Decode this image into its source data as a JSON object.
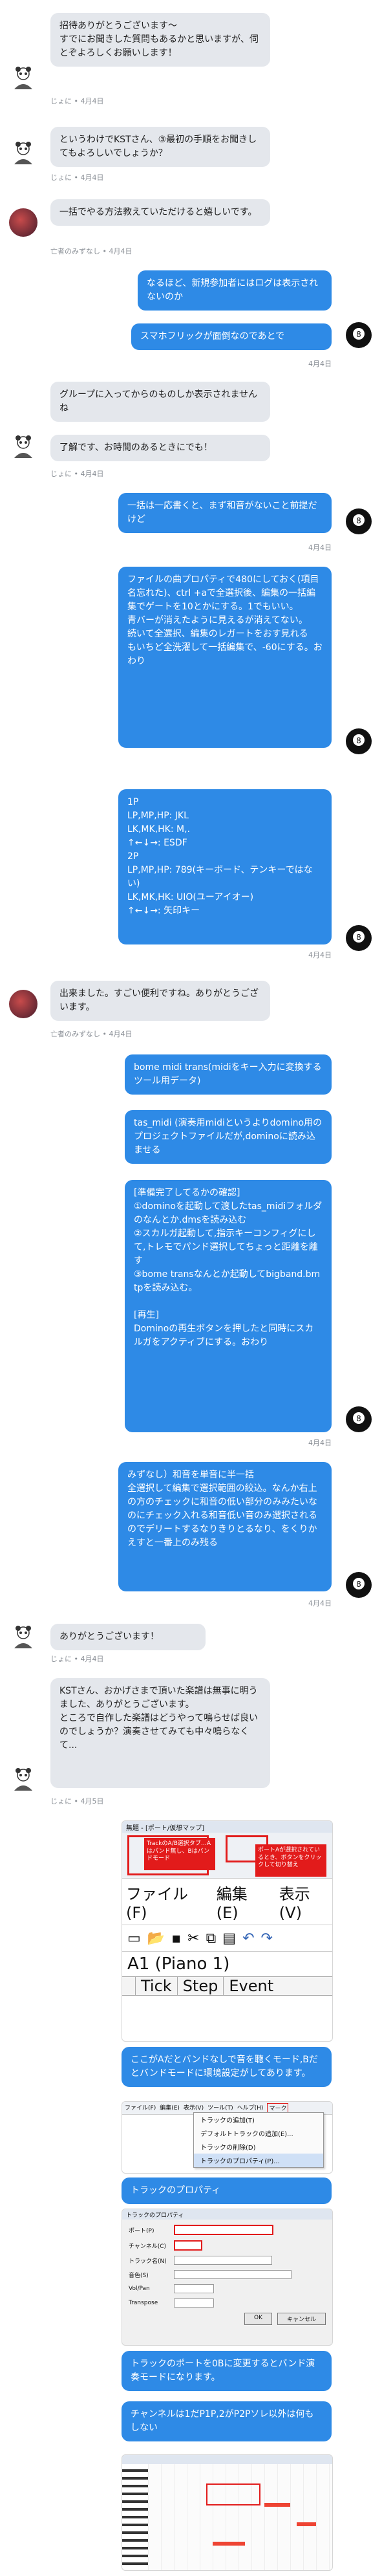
{
  "messages": [
    {
      "text": "招待ありがとうございます〜\nすでにお聞きした質問もあるかと思いますが、伺とぞよろしくお願いします！",
      "meta": "じょに • 4月4日"
    },
    {
      "text": "というわけでKSTさん、③最初の手順をお聞きしてもよろしいでしょうか？",
      "meta": "じょに • 4月4日"
    },
    {
      "text": "一括でやる方法教えていただけると嬉しいです。",
      "meta": "亡者のみずなし • 4月4日"
    },
    {
      "text": "なるほど、新規参加者にはログは表示されないのか"
    },
    {
      "text": "スマホフリックが面倒なのであとで",
      "meta": "4月4日"
    },
    {
      "text": "グループに入ってからのものしか表示されませんね"
    },
    {
      "text": "了解です、お時間のあるときにでも！",
      "meta": "じょに • 4月4日"
    },
    {
      "text": "一括は一応書くと、まず和音がないこと前提だけど",
      "meta": "4月4日"
    },
    {
      "text": "ファイルの曲プロパティで480にしておく(項目名忘れた)、ctrl +aで全選択後、編集の一括編集でゲートを10とかにする。1でもいい。\n青バーが消えたように見えるが消えてない。\n続いて全選択、編集のレガートをおす見れる\nもいちど全洗濯して一括編集で、-60にする。おわり"
    },
    {
      "text": "1P\n LP,MP,HP: JKL\n LK,MK,HK: M,.\n ↑←↓→: ESDF\n2P\n LP,MP,HP: 789(キーボード、テンキーではない)\n LK,MK,HK: UIO(ユーアイオー)\n ↑←↓→: 矢印キー",
      "meta": "4月4日"
    },
    {
      "text": "出来ました。すごい便利ですね。ありがとうございます。",
      "meta": "亡者のみずなし • 4月4日"
    },
    {
      "text": "bome midi trans(midiをキー入力に変換するツール用データ)"
    },
    {
      "text": "tas_midi (演奏用midiというよりdomino用のプロジェクトファイルだが,dominoに読み込ませる"
    },
    {
      "text": "[準備完了してるかの確認]\n①dominoを起動して渡したtas_midiフォルダのなんとか.dmsを読み込む\n②スカルガ起動して,指示キーコンフィグにして,トレモでパンド選択してちょっと距離を離す\n③bome transなんとか起動してbigband.bmtpを読み込む。\n\n[再生]\nDominoの再生ボタンを押したと同時にスカルガをアクティブにする。おわり",
      "meta": "4月4日"
    },
    {
      "text": "みずなし）和音を単音に半一括\n全選択して編集で選択範囲の絞込。なんか右上の方のチェックに和音の低い部分のみみたいなのにチェック入れる和音低い音のみ選択されるのでデリートするなりきりとるなり、をくりかえすと一番上のみ残る",
      "meta": "4月4日"
    },
    {
      "text": "ありがとうございます！",
      "meta": "じょに • 4月4日"
    },
    {
      "text": "KSTさん、おかげさまで頂いた楽譜は無事に明うました、ありがとうございます。\nところで自作した楽譜はどうやって鳴らせば良いのでしょうか？演奏させてみても中々鳴らなくて...",
      "meta": "じょに • 4月5日"
    },
    {
      "text": "ここがAだとバンドなしで音を聴くモード,Bだとバンドモードに環境設定がしてあります。"
    },
    {
      "text": "トラックのプロパティ"
    },
    {
      "text": "トラックのポートを0Bに変更するとバンド演奏モードになります。"
    },
    {
      "text": "チャンネルは1だP1P,2がP2Pソレ以外は何もしない"
    }
  ],
  "domino": {
    "titlebar": "無題 - [ポート/仮想マップ]",
    "menu": [
      "ファイル(F)",
      "編集(E)",
      "表示(V)"
    ],
    "track_name": "A1 (Piano 1)",
    "columns": [
      "Tick",
      "Step",
      "Event"
    ],
    "note1": "TrackのA/B選択タブ…Aはバンド無し、Bはバンドモード",
    "note2": "ポートAが選択されているとき、ボタンをクリックして切り替え",
    "menu2": [
      "ファイル(F)",
      "編集(E)",
      "表示(V)",
      "ツール(T)",
      "ヘルプ(H)",
      "マーク"
    ],
    "context_menu": [
      "トラックの追加(T)",
      "デフォルトトラックの追加(E)...",
      "トラックの削除(D)",
      "トラックのプロパティ(P)..."
    ],
    "prop_title": "トラックのプロパティ",
    "prop_rows": [
      "ポート(P)",
      "チャンネル(C)",
      "トラック名(N)",
      "音色(S)",
      "Vol/Pan",
      "Transpose"
    ],
    "ok": "OK",
    "cancel": "キャンセル"
  }
}
